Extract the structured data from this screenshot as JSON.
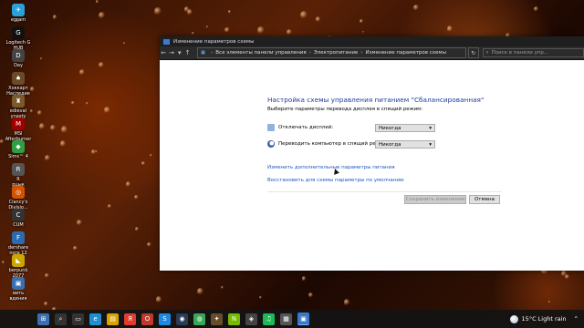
{
  "desktop": {
    "icons": [
      {
        "label": "egram",
        "color": "#2a9fd8",
        "glyph": "✈"
      },
      {
        "label": "Logitech G\nHUB",
        "color": "#111111",
        "glyph": "G"
      },
      {
        "label": "Day",
        "color": "#444444",
        "glyph": "D"
      },
      {
        "label": "Хоккарт\nНаследие",
        "color": "#6b4a2a",
        "glyph": "♠"
      },
      {
        "label": "edieval\nynasty",
        "color": "#7a5a2a",
        "glyph": "♜"
      },
      {
        "label": "MSI\nAfterburner",
        "color": "#a00000",
        "glyph": "M"
      },
      {
        "label": "Sims™ 4",
        "color": "#2f9e44",
        "glyph": "◆"
      },
      {
        "label": "R\nрцык",
        "color": "#555555",
        "glyph": "R"
      },
      {
        "label": "Clancy's\nDivisio...",
        "color": "#d35400",
        "glyph": "◎"
      },
      {
        "label": "CUM",
        "color": "#333333",
        "glyph": "C"
      },
      {
        "label": "dershare\nnora 12",
        "color": "#2b6cb0",
        "glyph": "F"
      },
      {
        "label": "berpunk\n2077",
        "color": "#c9a800",
        "glyph": "◣"
      },
      {
        "label": "вить\nвдения",
        "color": "#3a6fb0",
        "glyph": "▣"
      }
    ]
  },
  "window": {
    "title": "Изменение параметров схемы",
    "address": {
      "back": "←",
      "forward": "→",
      "dropdown": "▾",
      "up": "↑",
      "crumbs": [
        "Все элементы панели управления",
        "Электропитание",
        "Изменение параметров схемы"
      ],
      "refresh": "↻",
      "search_placeholder": "Поиск в панели упр..."
    },
    "heading": "Настройка схемы управления питанием \"Сбалансированная\"",
    "subtext": "Выберите параметры перевода дисплея в спящий режим:",
    "display_off": {
      "label": "Отключать дисплей:",
      "value": "Никогда"
    },
    "sleep": {
      "label": "Переводить компьютер в спящий режим:",
      "value": "Никогда"
    },
    "link_advanced": "Изменить дополнительные параметры питания",
    "link_restore": "Восстановить для схемы параметры по умолчанию",
    "save_label": "Сохранить изменения",
    "cancel_label": "Отмена"
  },
  "taskbar": {
    "apps": [
      {
        "name": "windows",
        "glyph": "⊞",
        "color": "#3a6fb0"
      },
      {
        "name": "search",
        "glyph": "⌕",
        "color": "#333333"
      },
      {
        "name": "task-view",
        "glyph": "▭",
        "color": "#333333"
      },
      {
        "name": "edge",
        "glyph": "e",
        "color": "#1f8fd0"
      },
      {
        "name": "explorer",
        "glyph": "▤",
        "color": "#d9a400"
      },
      {
        "name": "yandex",
        "glyph": "Я",
        "color": "#e03c2e"
      },
      {
        "name": "opera",
        "glyph": "O",
        "color": "#c0392b"
      },
      {
        "name": "skype",
        "glyph": "S",
        "color": "#1e88e5"
      },
      {
        "name": "steam",
        "glyph": "◉",
        "color": "#2b3a55"
      },
      {
        "name": "chrome",
        "glyph": "◍",
        "color": "#3aa757"
      },
      {
        "name": "game",
        "glyph": "✦",
        "color": "#6a4c2a"
      },
      {
        "name": "nvidia",
        "glyph": "N",
        "color": "#76b900"
      },
      {
        "name": "controller",
        "glyph": "◈",
        "color": "#444444"
      },
      {
        "name": "spotify",
        "glyph": "♫",
        "color": "#1db954"
      },
      {
        "name": "notes",
        "glyph": "▦",
        "color": "#555555"
      },
      {
        "name": "control-panel",
        "glyph": "▣",
        "color": "#3a79c9"
      }
    ],
    "weather": "15°C  Light rain",
    "more": "⌃"
  }
}
